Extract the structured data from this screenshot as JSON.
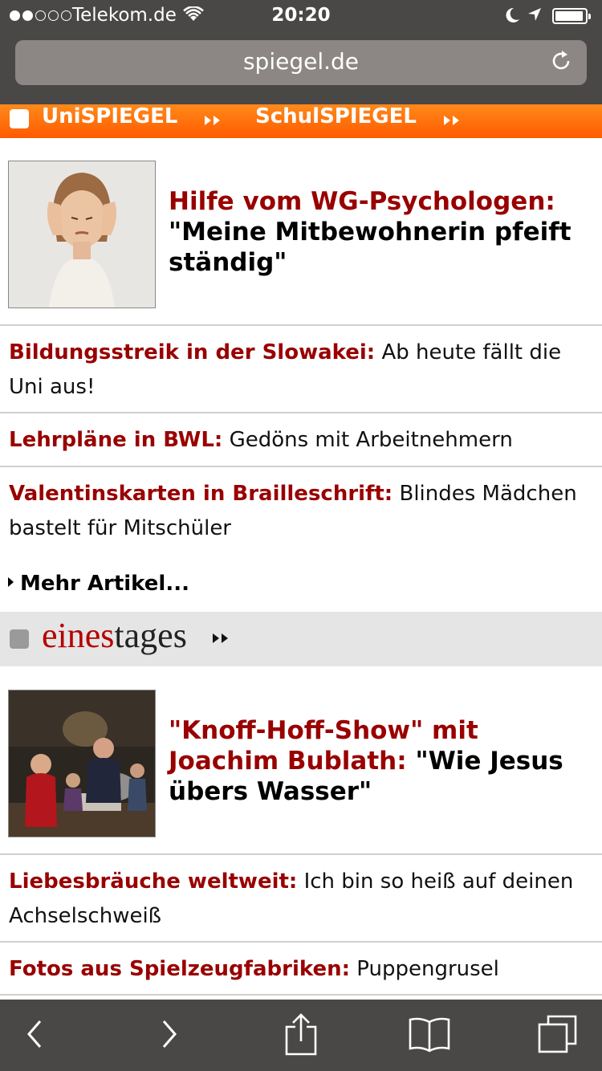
{
  "status_bar": {
    "carrier": "Telekom.de",
    "time": "20:20"
  },
  "browser": {
    "url": "spiegel.de"
  },
  "section_bar": {
    "uni_label": "UniSPIEGEL",
    "schul_label": "SchulSPIEGEL"
  },
  "feature1": {
    "kicker": "Hilfe vom WG-Psychologen:",
    "title": "\"Meine Mitbewohnerin pfeift ständig\""
  },
  "uni_items": [
    {
      "kicker": "Bildungsstreik in der Slowakei:",
      "text": "Ab heute fällt die Uni aus!"
    },
    {
      "kicker": "Lehrpläne in BWL:",
      "text": "Gedöns mit Arbeitnehmern"
    },
    {
      "kicker": "Valentinskarten in Brailleschrift:",
      "text": "Blindes Mädchen bastelt für Mitschüler"
    }
  ],
  "more_link": "Mehr Artikel...",
  "einestages": {
    "logo_part1": "eines",
    "logo_part2": "tages"
  },
  "feature2": {
    "kicker": "\"Knoff-Hoff-Show\" mit Joachim Bublath:",
    "title": "\"Wie Jesus übers Wasser\""
  },
  "eines_items": [
    {
      "kicker": "Liebesbräuche weltweit:",
      "text": "Ich bin so heiß auf deinen Achselschweiß"
    },
    {
      "kicker": "Fotos aus Spielzeugfabriken:",
      "text": "Puppengrusel"
    }
  ],
  "icons": {
    "back": "chevron-left-icon",
    "forward": "chevron-right-icon",
    "share": "share-icon",
    "bookmarks": "book-icon",
    "tabs": "tabs-icon"
  },
  "colors": {
    "kicker_red": "#990000",
    "section_orange": "#ff6a00",
    "chrome_dark": "#4a4846"
  }
}
